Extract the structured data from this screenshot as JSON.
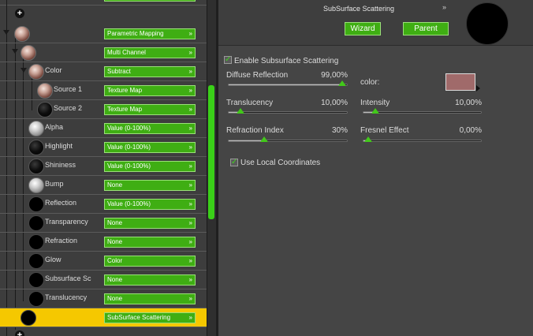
{
  "tree": {
    "nodes": [
      {
        "label": "",
        "value": "Parametric Mapping",
        "ball": "skin"
      },
      {
        "label": "",
        "value": "Multi Channel",
        "ball": "skin"
      },
      {
        "label": "Color",
        "value": "Subtract",
        "ball": "skin"
      },
      {
        "label": "Source 1",
        "value": "Texture Map",
        "ball": "skin"
      },
      {
        "label": "Source 2",
        "value": "Texture Map",
        "ball": "dark"
      },
      {
        "label": "Alpha",
        "value": "Value (0-100%)",
        "ball": "grey"
      },
      {
        "label": "Highlight",
        "value": "Value (0-100%)",
        "ball": "dark"
      },
      {
        "label": "Shininess",
        "value": "Value (0-100%)",
        "ball": "dark"
      },
      {
        "label": "Bump",
        "value": "None",
        "ball": "grey"
      },
      {
        "label": "Reflection",
        "value": "Value (0-100%)",
        "ball": "black"
      },
      {
        "label": "Transparency",
        "value": "None",
        "ball": "black"
      },
      {
        "label": "Refraction",
        "value": "None",
        "ball": "black"
      },
      {
        "label": "Glow",
        "value": "Color",
        "ball": "black"
      },
      {
        "label": "Subsurface Sc",
        "value": "None",
        "ball": "black"
      },
      {
        "label": "Translucency",
        "value": "None",
        "ball": "black"
      },
      {
        "label": "",
        "value": "SubSurface Scattering",
        "ball": "black"
      }
    ],
    "dropdown_arrow": "»"
  },
  "panel": {
    "title": "SubSurface Scattering",
    "collapse_glyph": "»",
    "wizard_label": "Wizard",
    "parent_label": "Parent",
    "enable_label": "Enable Subsurface Scattering",
    "diffuse": {
      "label": "Diffuse Reflection",
      "value": "99,00%",
      "level": 0.99
    },
    "color_label": "color:",
    "swatch_color": "#a06a6a",
    "translucency": {
      "label": "Translucency",
      "value": "10,00%",
      "level": 0.1
    },
    "intensity": {
      "label": "Intensity",
      "value": "10,00%",
      "level": 0.1
    },
    "refraction_index": {
      "label": "Refraction Index",
      "value": "30%",
      "level": 0.3
    },
    "fresnel": {
      "label": "Fresnel Effect",
      "value": "0,00%",
      "level": 0.0
    },
    "local_coords_label": "Use Local Coordinates"
  },
  "colors": {
    "accent_green": "#3fae13",
    "selection": "#f5c800"
  }
}
